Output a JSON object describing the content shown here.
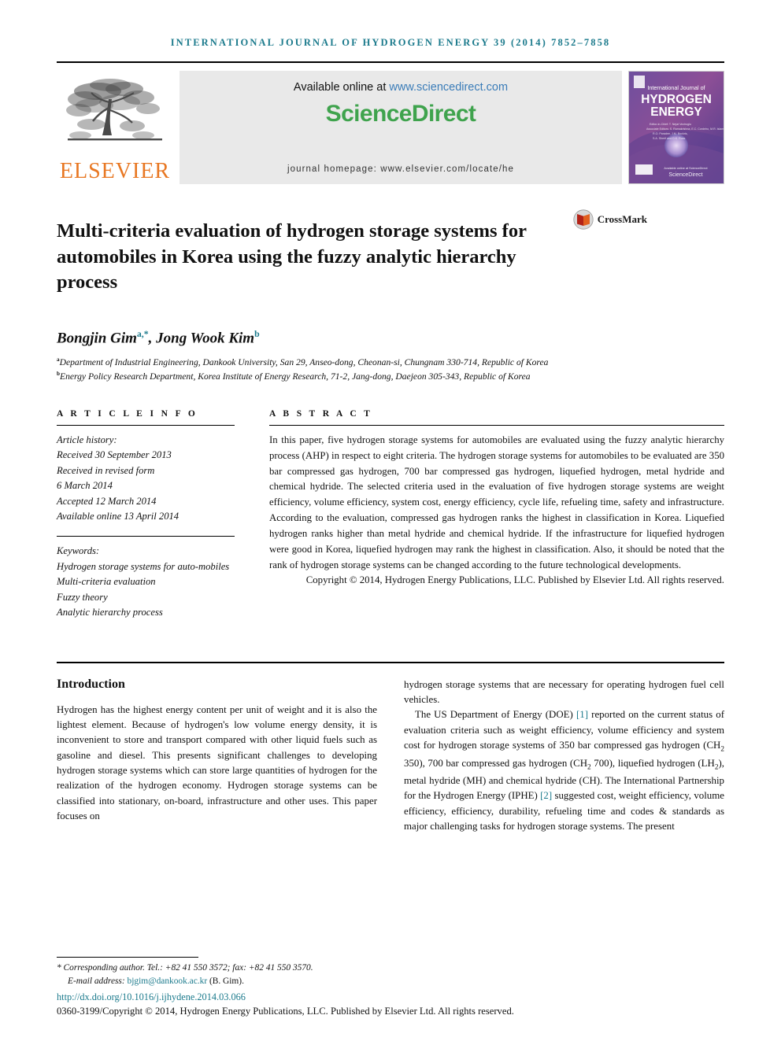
{
  "masthead": {
    "text": "International Journal of Hydrogen Energy 39 (2014) 7852–7858"
  },
  "header": {
    "publisher_name": "ELSEVIER",
    "available_online_prefix": "Available online at ",
    "sciencedirect_url": "www.sciencedirect.com",
    "sciencedirect_logo": "ScienceDirect",
    "journal_homepage": "journal homepage: www.elsevier.com/locate/he",
    "cover": {
      "line1": "International Journal of",
      "line2": "HYDROGEN",
      "line3": "ENERGY",
      "editors": "Editors-in-Chief: T. Nejat Veziroglu\nAssociate Editors: S. Ramakrishna, E.C. Cordeiro, M.R. Islam,\nR.O. Paradee, J.M. Bockris,\nS.A. Sherif and D.K. Ross",
      "footer_note": "Available online at ScienceDirect"
    }
  },
  "article": {
    "title": "Multi-criteria evaluation of hydrogen storage systems for automobiles in Korea using the fuzzy analytic hierarchy process",
    "crossmark_label": "CrossMark",
    "authors": [
      {
        "name": "Bongjin Gim",
        "marks": "a,*"
      },
      {
        "name": "Jong Wook Kim",
        "marks": "b"
      }
    ],
    "affiliations": [
      {
        "mark": "a",
        "text": "Department of Industrial Engineering, Dankook University, San 29, Anseo-dong, Cheonan-si, Chungnam 330-714, Republic of Korea"
      },
      {
        "mark": "b",
        "text": "Energy Policy Research Department, Korea Institute of Energy Research, 71-2, Jang-dong, Daejeon 305-343, Republic of Korea"
      }
    ]
  },
  "article_info": {
    "heading": "A R T I C L E   I N F O",
    "history_label": "Article history:",
    "history": [
      "Received 30 September 2013",
      "Received in revised form",
      "6 March 2014",
      "Accepted 12 March 2014",
      "Available online 13 April 2014"
    ],
    "keywords_label": "Keywords:",
    "keywords": [
      "Hydrogen storage systems for auto-mobiles",
      "Multi-criteria evaluation",
      "Fuzzy theory",
      "Analytic hierarchy process"
    ]
  },
  "abstract": {
    "heading": "A B S T R A C T",
    "text": "In this paper, five hydrogen storage systems for automobiles are evaluated using the fuzzy analytic hierarchy process (AHP) in respect to eight criteria. The hydrogen storage systems for automobiles to be evaluated are 350 bar compressed gas hydrogen, 700 bar compressed gas hydrogen, liquefied hydrogen, metal hydride and chemical hydride. The selected criteria used in the evaluation of five hydrogen storage systems are weight efficiency, volume efficiency, system cost, energy efficiency, cycle life, refueling time, safety and infrastructure. According to the evaluation, compressed gas hydrogen ranks the highest in classification in Korea. Liquefied hydrogen ranks higher than metal hydride and chemical hydride. If the infrastructure for liquefied hydrogen were good in Korea, liquefied hydrogen may rank the highest in classification. Also, it should be noted that the rank of hydrogen storage systems can be changed according to the future technological developments.",
    "copyright": "Copyright © 2014, Hydrogen Energy Publications, LLC. Published by Elsevier Ltd. All rights reserved."
  },
  "body": {
    "section_title": "Introduction",
    "left_paragraph": "Hydrogen has the highest energy content per unit of weight and it is also the lightest element. Because of hydrogen's low volume energy density, it is inconvenient to store and transport compared with other liquid fuels such as gasoline and diesel. This presents significant challenges to developing hydrogen storage systems which can store large quantities of hydrogen for the realization of the hydrogen economy. Hydrogen storage systems can be classified into stationary, on-board, infrastructure and other uses. This paper focuses on",
    "right_paragraph_continuation": "hydrogen storage systems that are necessary for operating hydrogen fuel cell vehicles.",
    "right_paragraph_2_part1": "The US Department of Energy (DOE) ",
    "right_citation_1": "[1]",
    "right_paragraph_2_part2": " reported on the current status of evaluation criteria such as weight efficiency, volume efficiency and system cost for hydrogen storage systems of 350 bar compressed gas hydrogen (CH",
    "right_sub_1": "2",
    "right_paragraph_2_part3": " 350), 700 bar compressed gas hydrogen (CH",
    "right_sub_2": "2",
    "right_paragraph_2_part4": " 700), liquefied hydrogen (LH",
    "right_sub_3": "2",
    "right_paragraph_2_part5": "), metal hydride (MH) and chemical hydride (CH). The International Partnership for the Hydrogen Energy (IPHE) ",
    "right_citation_2": "[2]",
    "right_paragraph_2_part6": " suggested cost, weight efficiency, volume efficiency, efficiency, durability, refueling time and codes & standards as major challenging tasks for hydrogen storage systems. The present"
  },
  "footer": {
    "corresponding_author": "* Corresponding author. Tel.: +82 41 550 3572; fax: +82 41 550 3570.",
    "email_label": "E-mail address: ",
    "email": "bjgim@dankook.ac.kr",
    "email_suffix": " (B. Gim).",
    "doi": "http://dx.doi.org/10.1016/j.ijhydene.2014.03.066",
    "issn_copyright": "0360-3199/Copyright © 2014, Hydrogen Energy Publications, LLC. Published by Elsevier Ltd. All rights reserved."
  },
  "colors": {
    "accent_teal": "#1b7a8c",
    "elsevier_orange": "#E87722",
    "sciencedirect_green": "#3fa34d",
    "link_blue": "#3a7cb8"
  }
}
